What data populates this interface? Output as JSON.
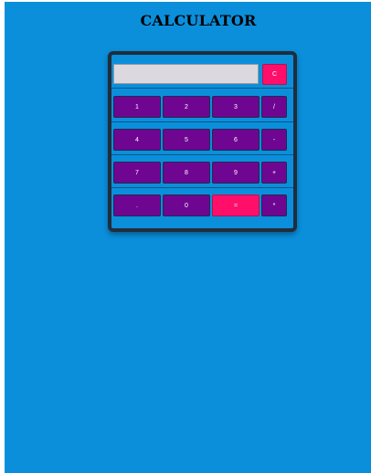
{
  "title": "CALCULATOR",
  "display": {
    "value": ""
  },
  "buttons": {
    "clear": "C",
    "divide": "/",
    "one": "1",
    "two": "2",
    "three": "3",
    "four": "4",
    "five": "5",
    "six": "6",
    "minus": "-",
    "seven": "7",
    "eight": "8",
    "nine": "9",
    "plus": "+",
    "dot": ".",
    "zero": "0",
    "equals": "=",
    "multiply": "*"
  },
  "colors": {
    "background": "#0b8fdb",
    "button": "#6f0691",
    "accent": "#ff0f6a",
    "display": "#dcd8df",
    "frame": "#1f2d3d"
  }
}
